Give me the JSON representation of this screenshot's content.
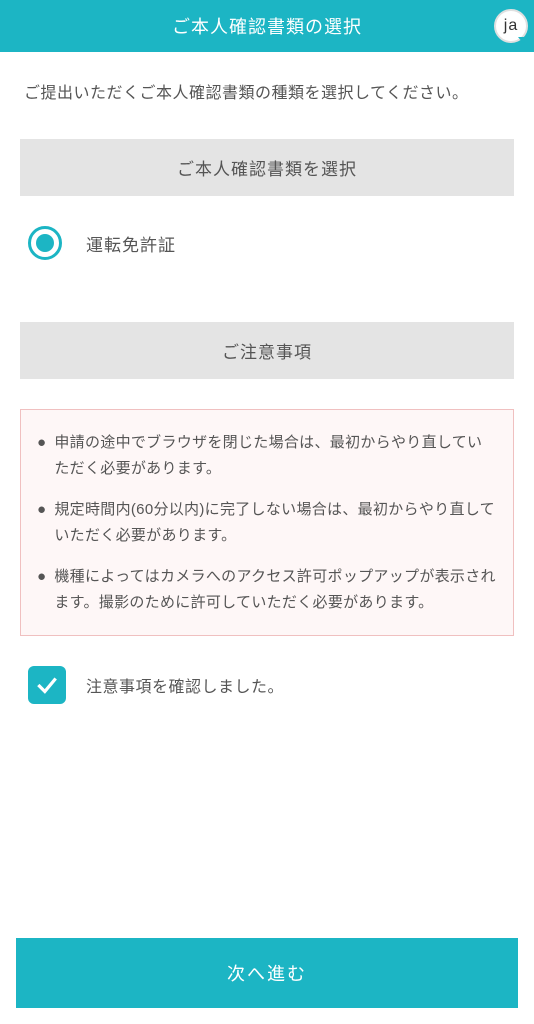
{
  "header": {
    "title": "ご本人確認書類の選択",
    "lang_label": "ja"
  },
  "instruction": "ご提出いただくご本人確認書類の種類を選択してください。",
  "sections": {
    "select_header": "ご本人確認書類を選択",
    "notice_header": "ご注意事項"
  },
  "document_option": {
    "label": "運転免許証",
    "selected": true
  },
  "notices": [
    "申請の途中でブラウザを閉じた場合は、最初からやり直していただく必要があります。",
    "規定時間内(60分以内)に完了しない場合は、最初からやり直していただく必要があります。",
    "機種によってはカメラへのアクセス許可ポップアップが表示されます。撮影のために許可していただく必要があります。"
  ],
  "confirm": {
    "label": "注意事項を確認しました。",
    "checked": true
  },
  "next_button": "次へ進む"
}
